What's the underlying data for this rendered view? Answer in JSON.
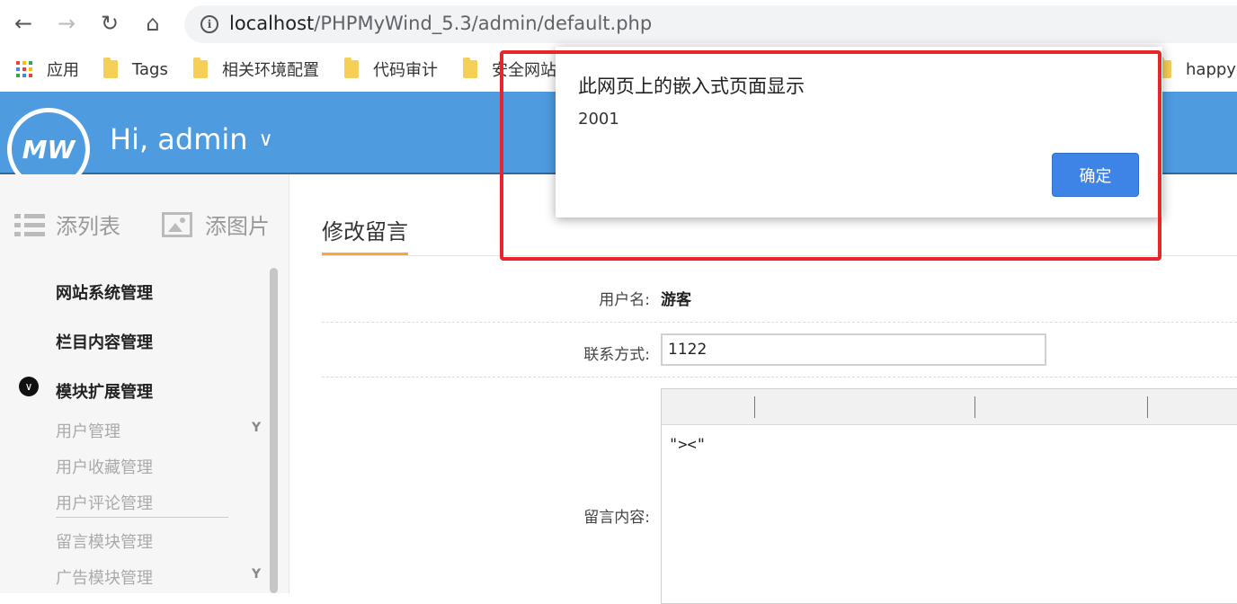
{
  "browser": {
    "url_host": "localhost",
    "url_path": "/PHPMyWind_5.3/admin/default.php",
    "nav_icons": [
      "back-arrow-icon",
      "forward-arrow-icon",
      "reload-icon",
      "home-icon",
      "info-icon"
    ]
  },
  "bookmarks": {
    "apps_label": "应用",
    "items": [
      "Tags",
      "相关环境配置",
      "代码审计",
      "安全网站",
      "happy"
    ]
  },
  "header": {
    "logo_text": "MW",
    "greeting": "Hi, admin",
    "accent_color": "#4e9be0"
  },
  "sidebar": {
    "quick_links": [
      "添列表",
      "添图片"
    ],
    "main_menu": [
      "网站系统管理",
      "栏目内容管理",
      "模块扩展管理"
    ],
    "sub_menu": [
      "用户管理",
      "用户收藏管理",
      "用户评论管理",
      "留言模块管理",
      "广告模块管理"
    ]
  },
  "main": {
    "title": "修改留言",
    "username_label": "用户名:",
    "username_value": "游客",
    "contact_label": "联系方式:",
    "contact_value": "1122",
    "content_label": "留言内容:",
    "content_value": "\"><\""
  },
  "dialog": {
    "title": "此网页上的嵌入式页面显示",
    "message": "2001",
    "ok_label": "确定",
    "highlight_color": "#e8252a"
  }
}
